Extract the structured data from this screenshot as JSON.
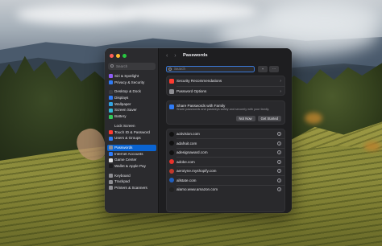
{
  "window": {
    "title": "Passwords",
    "nav_arrows": "‹ ›"
  },
  "sidebar": {
    "search_placeholder": "Search",
    "items": [
      {
        "label": "Siri & Spotlight",
        "icon": "siri-icon",
        "color": "#8e5cf5"
      },
      {
        "label": "Privacy & Security",
        "icon": "hand-icon",
        "color": "#2f7bf5"
      },
      {
        "label": "Desktop & Dock",
        "icon": "dock-icon",
        "color": "#3a3a3d"
      },
      {
        "label": "Displays",
        "icon": "display-icon",
        "color": "#2f7bf5"
      },
      {
        "label": "Wallpaper",
        "icon": "wallpaper-icon",
        "color": "#32a3e0"
      },
      {
        "label": "Screen Saver",
        "icon": "screensaver-icon",
        "color": "#32b8d6"
      },
      {
        "label": "Battery",
        "icon": "battery-icon",
        "color": "#34c759"
      },
      {
        "label": "Lock Screen",
        "icon": "lock-icon",
        "color": "#2b2b2e"
      },
      {
        "label": "Touch ID & Password",
        "icon": "fingerprint-icon",
        "color": "#ff3b30"
      },
      {
        "label": "Users & Groups",
        "icon": "users-icon",
        "color": "#2f7bf5"
      },
      {
        "label": "Passwords",
        "icon": "key-icon",
        "color": "#8e8e93"
      },
      {
        "label": "Internet Accounts",
        "icon": "at-icon",
        "color": "#2f7bf5"
      },
      {
        "label": "Game Center",
        "icon": "gamecenter-icon",
        "color": "#e0e0e0"
      },
      {
        "label": "Wallet & Apple Pay",
        "icon": "wallet-icon",
        "color": "#1c1c1e"
      },
      {
        "label": "Keyboard",
        "icon": "keyboard-icon",
        "color": "#8e8e93"
      },
      {
        "label": "Trackpad",
        "icon": "trackpad-icon",
        "color": "#8e8e93"
      },
      {
        "label": "Printers & Scanners",
        "icon": "printer-icon",
        "color": "#8e8e93"
      }
    ],
    "active": "Passwords"
  },
  "main": {
    "search_placeholder": "Search",
    "add_label": "+",
    "more_label": "···",
    "top_rows": [
      {
        "label": "Security Recommendations",
        "icon": "alert-icon",
        "color": "#ff3b30"
      },
      {
        "label": "Password Options",
        "icon": "gear-icon",
        "color": "#8e8e93"
      }
    ],
    "family": {
      "title": "Share Passwords with Family",
      "subtitle": "Share passwords and passkeys safely and securely with your family.",
      "not_now": "Not Now",
      "get_started": "Get Started"
    },
    "credentials": [
      {
        "site": "activision.com",
        "icon": "activision-icon",
        "color": "#111111"
      },
      {
        "site": "adafruit.com",
        "icon": "adafruit-icon",
        "color": "#111111"
      },
      {
        "site": "adesignaward.com",
        "icon": "adesignaward-icon",
        "color": "#111111"
      },
      {
        "site": "adobe.com",
        "icon": "adobe-icon",
        "color": "#e8322b"
      },
      {
        "site": "aerotyne.myshopify.com",
        "icon": "shopify-icon",
        "color": "#c0392b"
      },
      {
        "site": "allstate.com",
        "icon": "allstate-icon",
        "color": "#1f5fbf"
      },
      {
        "site": "alamo.www.amazon.com",
        "icon": "amazon-icon",
        "color": "#222222"
      }
    ]
  }
}
